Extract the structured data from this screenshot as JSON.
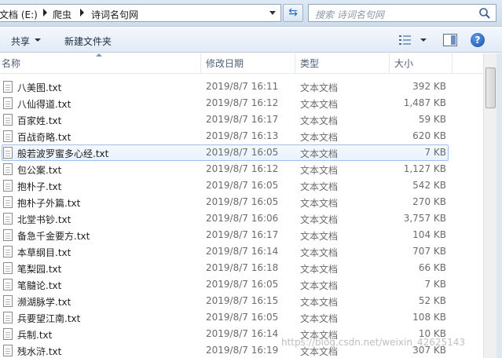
{
  "address": {
    "crumbs": [
      "文档 (E:)",
      "爬虫",
      "诗词名句网"
    ]
  },
  "search": {
    "placeholder": "搜索 诗词名句网"
  },
  "toolbar": {
    "share_label": "共享",
    "new_folder_label": "新建文件夹"
  },
  "columns": {
    "name": "名称",
    "date": "修改日期",
    "type": "类型",
    "size": "大小"
  },
  "files": [
    {
      "name": "八美图.txt",
      "date": "2019/8/7 16:11",
      "type": "文本文档",
      "size": "392 KB"
    },
    {
      "name": "八仙得道.txt",
      "date": "2019/8/7 16:12",
      "type": "文本文档",
      "size": "1,487 KB"
    },
    {
      "name": "百家姓.txt",
      "date": "2019/8/7 16:17",
      "type": "文本文档",
      "size": "59 KB"
    },
    {
      "name": "百战奇略.txt",
      "date": "2019/8/7 16:13",
      "type": "文本文档",
      "size": "620 KB"
    },
    {
      "name": "般若波罗蜜多心经.txt",
      "date": "2019/8/7 16:05",
      "type": "文本文档",
      "size": "7 KB"
    },
    {
      "name": "包公案.txt",
      "date": "2019/8/7 16:12",
      "type": "文本文档",
      "size": "1,127 KB"
    },
    {
      "name": "抱朴子.txt",
      "date": "2019/8/7 16:05",
      "type": "文本文档",
      "size": "542 KB"
    },
    {
      "name": "抱朴子外篇.txt",
      "date": "2019/8/7 16:05",
      "type": "文本文档",
      "size": "270 KB"
    },
    {
      "name": "北堂书钞.txt",
      "date": "2019/8/7 16:06",
      "type": "文本文档",
      "size": "3,757 KB"
    },
    {
      "name": "备急千金要方.txt",
      "date": "2019/8/7 16:17",
      "type": "文本文档",
      "size": "104 KB"
    },
    {
      "name": "本草纲目.txt",
      "date": "2019/8/7 16:14",
      "type": "文本文档",
      "size": "707 KB"
    },
    {
      "name": "笔梨园.txt",
      "date": "2019/8/7 16:18",
      "type": "文本文档",
      "size": "66 KB"
    },
    {
      "name": "笔髓论.txt",
      "date": "2019/8/7 16:05",
      "type": "文本文档",
      "size": "7 KB"
    },
    {
      "name": "濒湖脉学.txt",
      "date": "2019/8/7 16:15",
      "type": "文本文档",
      "size": "52 KB"
    },
    {
      "name": "兵要望江南.txt",
      "date": "2019/8/7 16:05",
      "type": "文本文档",
      "size": "108 KB"
    },
    {
      "name": "兵制.txt",
      "date": "2019/8/7 16:14",
      "type": "文本文档",
      "size": "10 KB"
    },
    {
      "name": "残水浒.txt",
      "date": "2019/8/7 16:19",
      "type": "文本文档",
      "size": "307 KB"
    }
  ],
  "watermark": "https://blog.csdn.net/weixin_42625143"
}
